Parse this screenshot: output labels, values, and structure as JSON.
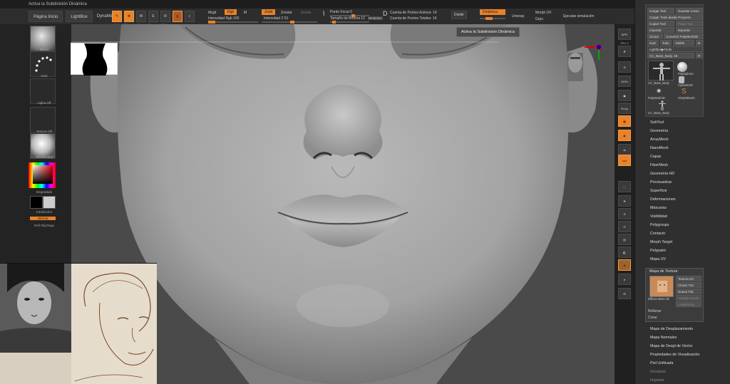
{
  "titlebar": {
    "text": "Activa la Subdivisión Dinámica"
  },
  "menubar": {
    "items": [
      "Página Inicio",
      "LightBox",
      "DynaMesh"
    ]
  },
  "toolbar": {
    "edit": "Edit",
    "draw": "Dibujar",
    "move": "Mover",
    "scale": "Escalar",
    "rotate": "Rotar",
    "mrgb": "Mrgb",
    "rgb": "Rgb",
    "m": "M",
    "intensity_rgb": "Intensidad Rgb 100",
    "zadd": "Zadd",
    "zsub": "Zrestar",
    "zcut": "Zcorta",
    "z_intensity": "Intensidad Z 51",
    "focal_point": "Punto Focal 0",
    "brush_size": "Tamaño de Brocha 12",
    "dynamic": "Dinámico",
    "active_points": "Cuenta de Puntos Activos: 14",
    "total_points": "Cuenta de Puntos Totales: 14",
    "divide": "Dividir",
    "dynamic_sub": "Dinámica",
    "unwrap": "Unwrap",
    "morph_uv": "Morph UV",
    "grps": "Grps",
    "run_sim": "Ejecutar simulación"
  },
  "tooltip": "Activa la Subdivisión Dinámica",
  "leftshelf": {
    "brush": "Mover",
    "stroke": "Dots",
    "alpha": "Alpha Off",
    "texture": "Texture Off",
    "material": "SkinShaded",
    "gradient": "Degradado",
    "switch_color": "CambColor",
    "alternate": "Alternar",
    "rellobj": "Rell Obj Dego"
  },
  "rightshelf": {
    "items": [
      "BPR",
      "SPix 3",
      "Scroll",
      "Zoom2D",
      "100%",
      "AAHalf",
      "Persp",
      "Floor",
      "Local",
      "Sym",
      "Frame",
      "Move",
      "Zoom3D",
      "Rotate",
      "PolyF",
      "Transp",
      "Ghost",
      "Solo",
      "Xpose"
    ]
  },
  "tool_panel": {
    "load_tool": "Cargar Tool",
    "save_as": "Guardar Como",
    "load_from_project": "Cargar Tools desde Proyecto",
    "copy_tool": "Copiar Tool",
    "paste_tool": "Pegar Tool",
    "import": "Importar",
    "export": "Exportar",
    "clone": "Clonar",
    "make_polymesh": "Convertir PolyMesh3D",
    "goz": "GoZ",
    "all": "Todo",
    "visible": "Visible",
    "r": "R",
    "lightbox_tools": "Lightbox▶Tools",
    "current_tool": "CC_Base_Body. 49",
    "thumbs": [
      "CC_Base_Body",
      "PolySphere",
      "Cylinder3D",
      "PolyMesh3D",
      "SimpleBrush",
      "CC_Base_Body"
    ]
  },
  "menu_top": [
    "SubTool",
    "Geometría",
    "ArrayMesh",
    "NanoMesh",
    "Capas",
    "FiberMesh",
    "Geometría HD",
    "Previsualizar",
    "Superficie",
    "Deformaciones",
    "Máscaras",
    "Visibilidad",
    "Polygroups",
    "Contacto",
    "Morph Target",
    "Polypaint",
    "Mapa UV"
  ],
  "texture_panel": {
    "title": "Mapa de Textura",
    "texture_on": "Textura On",
    "clone_txtr": "Clonar Txtr",
    "new_txtr": "Nueva Txtr",
    "thumb_label": "Diffuse Base Sk",
    "fill": "Rellenar",
    "create": "Crear",
    "dim1": "Arreglar Borde",
    "dim2": "Antialiasing"
  },
  "menu_bottom": [
    "Mapa de Desplazamiento",
    "Mapa Normales",
    "Mapa de Despl de Vector",
    "Propiedades de Visualización",
    "Piel Unificada",
    "Inicializar",
    "Importar"
  ],
  "colors": {
    "accent": "#e9822a",
    "bg": "#262626",
    "viewport": "#8e8e8e"
  }
}
